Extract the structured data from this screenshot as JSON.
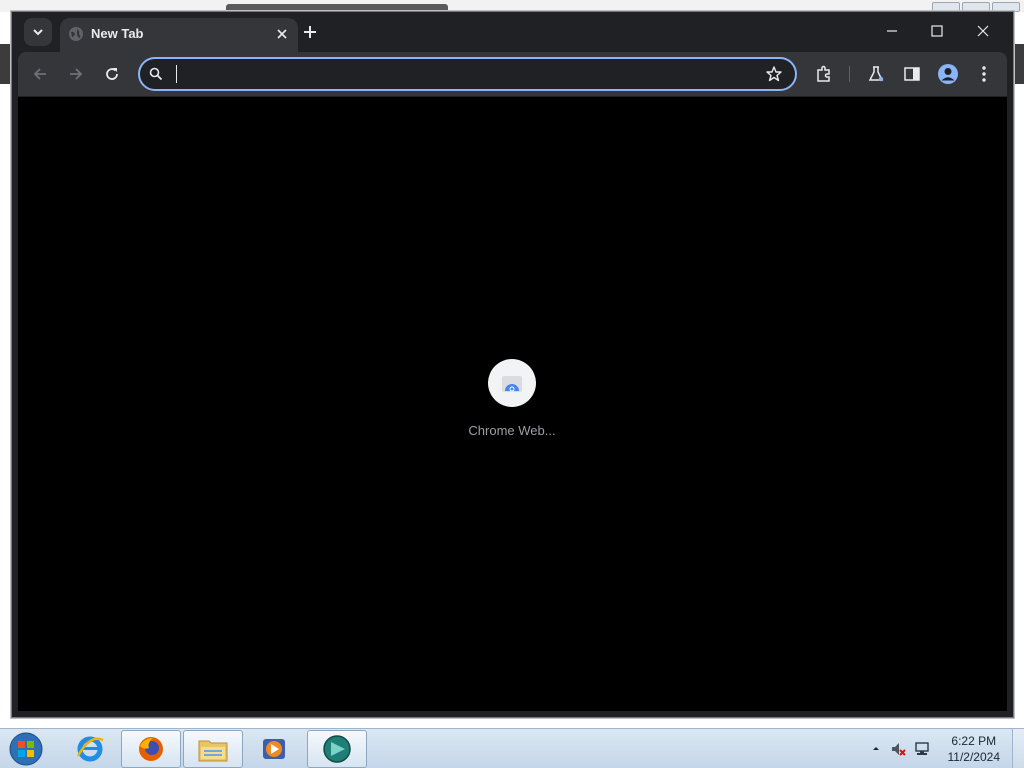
{
  "browser": {
    "tab": {
      "title": "New Tab"
    },
    "omnibox": {
      "value": "",
      "placeholder": ""
    },
    "shortcut": {
      "label": "Chrome Web..."
    },
    "accent": "#8ab4f8"
  },
  "taskbar": {
    "apps": [
      {
        "icon": "internet-explorer-icon"
      },
      {
        "icon": "firefox-icon"
      },
      {
        "icon": "file-explorer-icon"
      },
      {
        "icon": "media-player-icon"
      },
      {
        "icon": "app-icon"
      }
    ],
    "clock": {
      "time": "6:22 PM",
      "date": "11/2/2024"
    }
  }
}
